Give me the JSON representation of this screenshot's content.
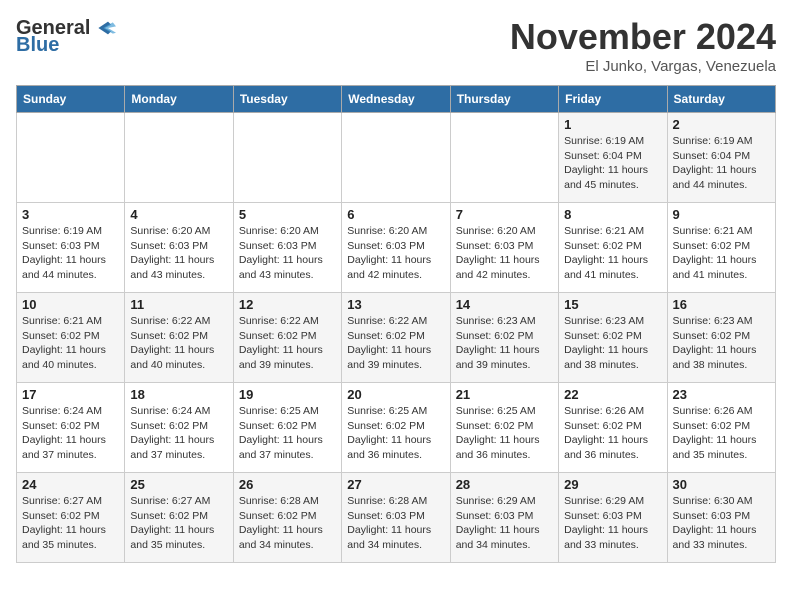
{
  "header": {
    "logo_general": "General",
    "logo_blue": "Blue",
    "month_title": "November 2024",
    "location": "El Junko, Vargas, Venezuela"
  },
  "weekdays": [
    "Sunday",
    "Monday",
    "Tuesday",
    "Wednesday",
    "Thursday",
    "Friday",
    "Saturday"
  ],
  "weeks": [
    [
      {
        "day": "",
        "info": ""
      },
      {
        "day": "",
        "info": ""
      },
      {
        "day": "",
        "info": ""
      },
      {
        "day": "",
        "info": ""
      },
      {
        "day": "",
        "info": ""
      },
      {
        "day": "1",
        "info": "Sunrise: 6:19 AM\nSunset: 6:04 PM\nDaylight: 11 hours and 45 minutes."
      },
      {
        "day": "2",
        "info": "Sunrise: 6:19 AM\nSunset: 6:04 PM\nDaylight: 11 hours and 44 minutes."
      }
    ],
    [
      {
        "day": "3",
        "info": "Sunrise: 6:19 AM\nSunset: 6:03 PM\nDaylight: 11 hours and 44 minutes."
      },
      {
        "day": "4",
        "info": "Sunrise: 6:20 AM\nSunset: 6:03 PM\nDaylight: 11 hours and 43 minutes."
      },
      {
        "day": "5",
        "info": "Sunrise: 6:20 AM\nSunset: 6:03 PM\nDaylight: 11 hours and 43 minutes."
      },
      {
        "day": "6",
        "info": "Sunrise: 6:20 AM\nSunset: 6:03 PM\nDaylight: 11 hours and 42 minutes."
      },
      {
        "day": "7",
        "info": "Sunrise: 6:20 AM\nSunset: 6:03 PM\nDaylight: 11 hours and 42 minutes."
      },
      {
        "day": "8",
        "info": "Sunrise: 6:21 AM\nSunset: 6:02 PM\nDaylight: 11 hours and 41 minutes."
      },
      {
        "day": "9",
        "info": "Sunrise: 6:21 AM\nSunset: 6:02 PM\nDaylight: 11 hours and 41 minutes."
      }
    ],
    [
      {
        "day": "10",
        "info": "Sunrise: 6:21 AM\nSunset: 6:02 PM\nDaylight: 11 hours and 40 minutes."
      },
      {
        "day": "11",
        "info": "Sunrise: 6:22 AM\nSunset: 6:02 PM\nDaylight: 11 hours and 40 minutes."
      },
      {
        "day": "12",
        "info": "Sunrise: 6:22 AM\nSunset: 6:02 PM\nDaylight: 11 hours and 39 minutes."
      },
      {
        "day": "13",
        "info": "Sunrise: 6:22 AM\nSunset: 6:02 PM\nDaylight: 11 hours and 39 minutes."
      },
      {
        "day": "14",
        "info": "Sunrise: 6:23 AM\nSunset: 6:02 PM\nDaylight: 11 hours and 39 minutes."
      },
      {
        "day": "15",
        "info": "Sunrise: 6:23 AM\nSunset: 6:02 PM\nDaylight: 11 hours and 38 minutes."
      },
      {
        "day": "16",
        "info": "Sunrise: 6:23 AM\nSunset: 6:02 PM\nDaylight: 11 hours and 38 minutes."
      }
    ],
    [
      {
        "day": "17",
        "info": "Sunrise: 6:24 AM\nSunset: 6:02 PM\nDaylight: 11 hours and 37 minutes."
      },
      {
        "day": "18",
        "info": "Sunrise: 6:24 AM\nSunset: 6:02 PM\nDaylight: 11 hours and 37 minutes."
      },
      {
        "day": "19",
        "info": "Sunrise: 6:25 AM\nSunset: 6:02 PM\nDaylight: 11 hours and 37 minutes."
      },
      {
        "day": "20",
        "info": "Sunrise: 6:25 AM\nSunset: 6:02 PM\nDaylight: 11 hours and 36 minutes."
      },
      {
        "day": "21",
        "info": "Sunrise: 6:25 AM\nSunset: 6:02 PM\nDaylight: 11 hours and 36 minutes."
      },
      {
        "day": "22",
        "info": "Sunrise: 6:26 AM\nSunset: 6:02 PM\nDaylight: 11 hours and 36 minutes."
      },
      {
        "day": "23",
        "info": "Sunrise: 6:26 AM\nSunset: 6:02 PM\nDaylight: 11 hours and 35 minutes."
      }
    ],
    [
      {
        "day": "24",
        "info": "Sunrise: 6:27 AM\nSunset: 6:02 PM\nDaylight: 11 hours and 35 minutes."
      },
      {
        "day": "25",
        "info": "Sunrise: 6:27 AM\nSunset: 6:02 PM\nDaylight: 11 hours and 35 minutes."
      },
      {
        "day": "26",
        "info": "Sunrise: 6:28 AM\nSunset: 6:02 PM\nDaylight: 11 hours and 34 minutes."
      },
      {
        "day": "27",
        "info": "Sunrise: 6:28 AM\nSunset: 6:03 PM\nDaylight: 11 hours and 34 minutes."
      },
      {
        "day": "28",
        "info": "Sunrise: 6:29 AM\nSunset: 6:03 PM\nDaylight: 11 hours and 34 minutes."
      },
      {
        "day": "29",
        "info": "Sunrise: 6:29 AM\nSunset: 6:03 PM\nDaylight: 11 hours and 33 minutes."
      },
      {
        "day": "30",
        "info": "Sunrise: 6:30 AM\nSunset: 6:03 PM\nDaylight: 11 hours and 33 minutes."
      }
    ]
  ]
}
